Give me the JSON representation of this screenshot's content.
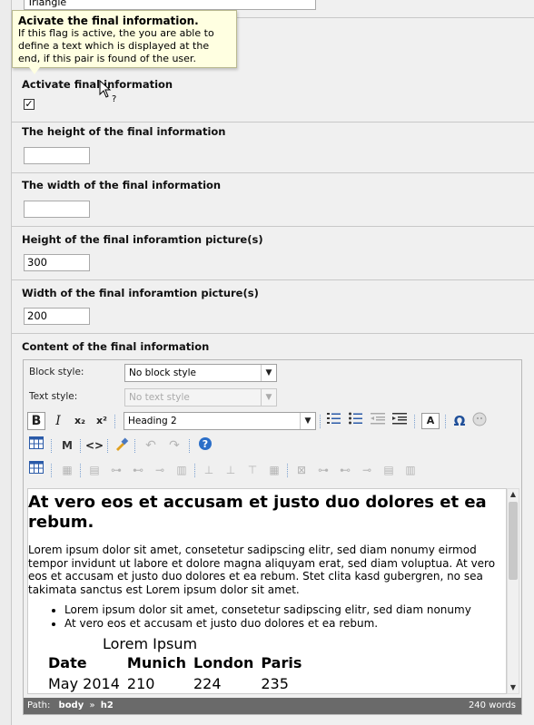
{
  "top_field": {
    "value": "Triangle"
  },
  "tooltip": {
    "title": "Acivate the final information.",
    "lines": [
      "If this flag is active, the you are able to",
      "define a text which is displayed at the",
      "end, if this pair is found of the user."
    ]
  },
  "fields": {
    "activate": {
      "label": "Activate final information",
      "checked_glyph": "✓"
    },
    "height": {
      "label": "The height of the final information",
      "value": ""
    },
    "width": {
      "label": "The width of the final information",
      "value": ""
    },
    "pic_height": {
      "label": "Height of the final inforamtion picture(s)",
      "value": "300"
    },
    "pic_width": {
      "label": "Width of the final inforamtion picture(s)",
      "value": "200"
    },
    "content": {
      "label": "Content of the final information"
    }
  },
  "editor": {
    "block_style_label": "Block style:",
    "block_style_value": "No block style",
    "text_style_label": "Text style:",
    "text_style_value": "No text style",
    "format_value": "Heading 2",
    "toolbar": {
      "bold": "B",
      "italic": "I",
      "subscript": "x₂",
      "superscript": "x²",
      "find": "M",
      "source": "<>",
      "omega": "Ω",
      "font_color": "A"
    },
    "doc": {
      "heading": "At vero eos et accusam et justo duo dolores et ea rebum.",
      "paragraph": "Lorem ipsum dolor sit amet, consetetur sadipscing elitr, sed diam nonumy eirmod tempor invidunt ut labore et dolore magna aliquyam erat, sed diam voluptua. At vero eos et accusam et justo duo dolores et ea rebum. Stet clita kasd gubergren, no sea takimata sanctus est Lorem ipsum dolor sit amet.",
      "bullets": [
        "Lorem ipsum dolor sit amet, consetetur sadipscing elitr, sed diam nonumy",
        "At vero eos et accusam et justo duo dolores et ea rebum."
      ],
      "table_caption": "Lorem Ipsum",
      "table_headers": [
        "Date",
        "Munich",
        "London",
        "Paris"
      ],
      "table_row": [
        "May 2014",
        "210",
        "224",
        "235"
      ]
    },
    "status": {
      "path_label": "Path:",
      "path_body": "body",
      "path_sep": "»",
      "path_el": "h2",
      "words": "240 words"
    }
  },
  "colors": {
    "tooltip_bg": "#ffffe1",
    "statusbar_bg": "#6a6a6a",
    "separator": "#7aa0d0"
  }
}
